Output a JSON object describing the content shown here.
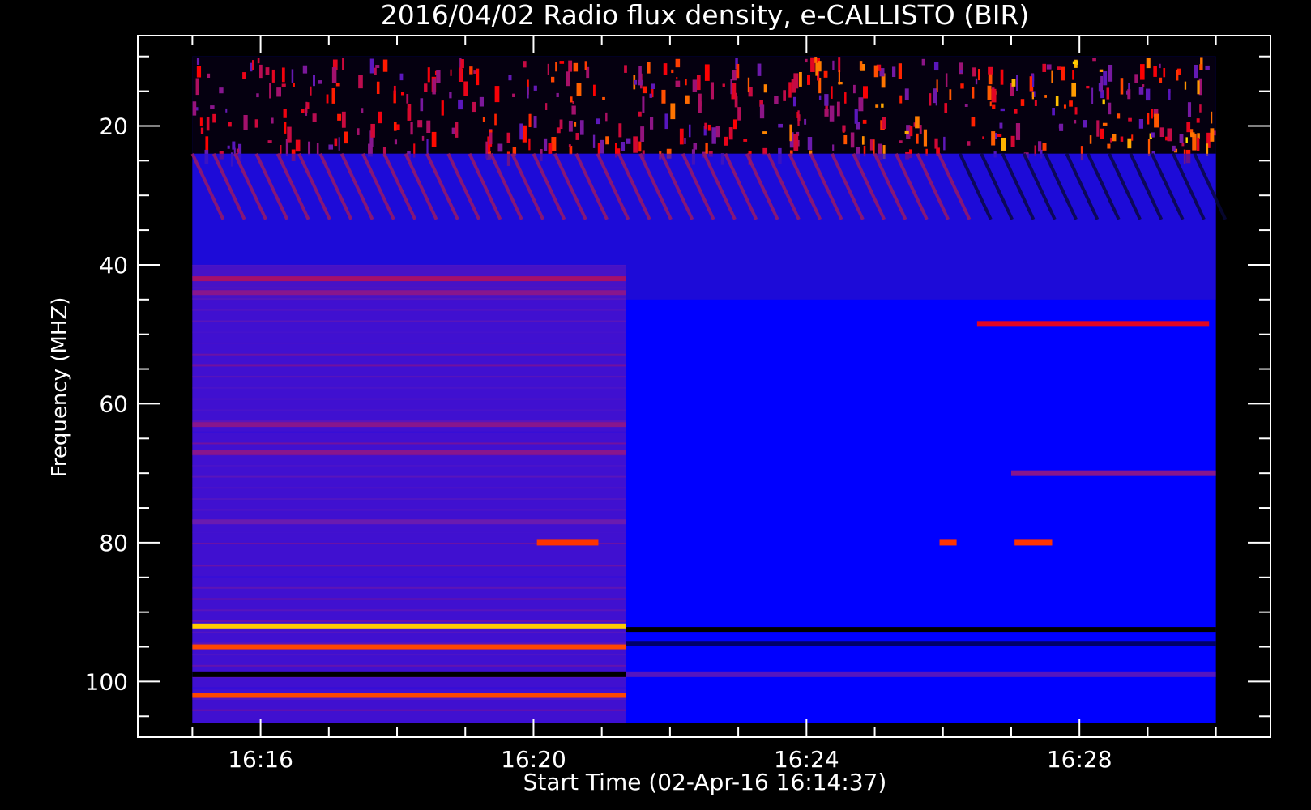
{
  "chart_data": {
    "type": "heatmap",
    "title": "2016/04/02  Radio flux density, e-CALLISTO (BIR)",
    "xlabel": "Start Time (02-Apr-16 16:14:37)",
    "ylabel": "Frequency (MHZ)",
    "x_ticks": [
      "16:16",
      "16:20",
      "16:24",
      "16:28"
    ],
    "x_tick_minutes": [
      16,
      20,
      24,
      28
    ],
    "x_range_minutes": [
      14.2,
      30.8
    ],
    "data_x_range_minutes": [
      15.0,
      30.0
    ],
    "y_ticks": [
      20,
      40,
      60,
      80,
      100
    ],
    "ylim": [
      108,
      7
    ],
    "data_y_range_mhz": [
      10,
      106
    ],
    "grid": false,
    "colormap": [
      "#000000",
      "#0000ff",
      "#6a1bb0",
      "#ff0000",
      "#ffff00"
    ],
    "background": "#0000ff",
    "features": [
      {
        "kind": "noise-band",
        "t_start": 15.0,
        "t_end": 30.0,
        "f_start": 10,
        "f_end": 24,
        "level": 0.75
      },
      {
        "kind": "stripes",
        "t_start": 15.0,
        "t_end": 30.0,
        "f_start": 24,
        "f_end": 45,
        "level": 0.45
      },
      {
        "kind": "region",
        "t_start": 15.0,
        "t_end": 21.35,
        "f_start": 40,
        "f_end": 106,
        "level": 0.45
      },
      {
        "kind": "line",
        "t_start": 15.0,
        "t_end": 21.35,
        "freq": 42,
        "level": 0.6
      },
      {
        "kind": "line",
        "t_start": 15.0,
        "t_end": 21.35,
        "freq": 44,
        "level": 0.55
      },
      {
        "kind": "line",
        "t_start": 15.0,
        "t_end": 21.35,
        "freq": 63,
        "level": 0.55
      },
      {
        "kind": "line",
        "t_start": 15.0,
        "t_end": 21.35,
        "freq": 67,
        "level": 0.55
      },
      {
        "kind": "line",
        "t_start": 15.0,
        "t_end": 21.35,
        "freq": 77,
        "level": 0.5
      },
      {
        "kind": "line",
        "t_start": 15.0,
        "t_end": 21.35,
        "freq": 92,
        "level": 0.95
      },
      {
        "kind": "line",
        "t_start": 15.0,
        "t_end": 21.35,
        "freq": 95,
        "level": 0.82
      },
      {
        "kind": "line",
        "t_start": 15.0,
        "t_end": 21.35,
        "freq": 102,
        "level": 0.82
      },
      {
        "kind": "line",
        "t_start": 21.35,
        "t_end": 30.0,
        "freq": 92.5,
        "level": 0.0
      },
      {
        "kind": "line",
        "t_start": 21.35,
        "t_end": 30.0,
        "freq": 94.5,
        "level": 0.1
      },
      {
        "kind": "line",
        "t_start": 21.35,
        "t_end": 30.0,
        "freq": 99,
        "level": 0.45
      },
      {
        "kind": "line",
        "t_start": 15.0,
        "t_end": 21.35,
        "freq": 99,
        "level": 0.0
      },
      {
        "kind": "blip",
        "t_start": 20.05,
        "t_end": 20.95,
        "freq": 80,
        "level": 0.8
      },
      {
        "kind": "blip",
        "t_start": 25.95,
        "t_end": 26.2,
        "freq": 80,
        "level": 0.8
      },
      {
        "kind": "blip",
        "t_start": 27.05,
        "t_end": 27.6,
        "freq": 80,
        "level": 0.8
      },
      {
        "kind": "blip",
        "t_start": 26.5,
        "t_end": 29.9,
        "freq": 48.5,
        "level": 0.7
      },
      {
        "kind": "blip",
        "t_start": 27.0,
        "t_end": 30.0,
        "freq": 70,
        "level": 0.55
      }
    ]
  }
}
